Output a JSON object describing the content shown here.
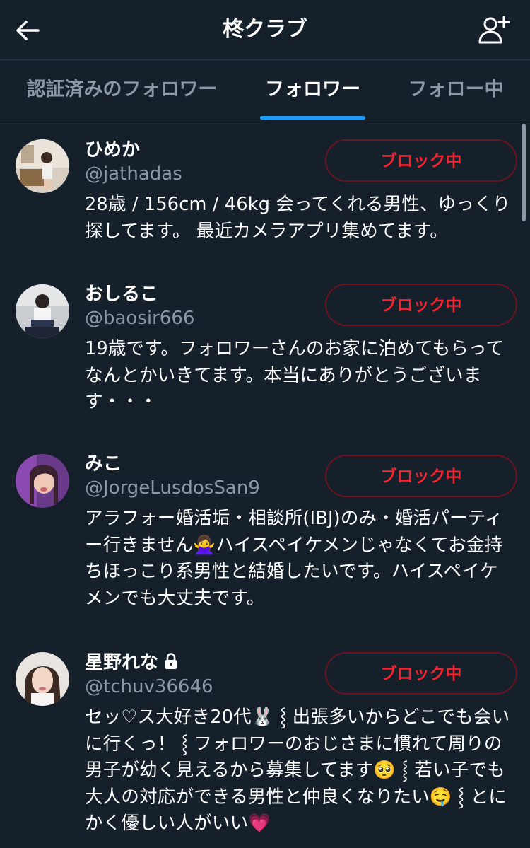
{
  "header": {
    "title": "柊クラブ",
    "back_icon": "arrow-left-icon",
    "add_user_icon": "person-add-icon"
  },
  "tabs": [
    {
      "label": "認証済みのフォロワー",
      "active": false
    },
    {
      "label": "フォロワー",
      "active": true
    },
    {
      "label": "フォロー中",
      "active": false
    }
  ],
  "colors": {
    "background": "#15202b",
    "accent": "#1d9bf0",
    "block_red": "#f4212e",
    "secondary_text": "#8b98a5"
  },
  "followers": [
    {
      "name": "ひめか",
      "handle": "@jathadas",
      "bio": "28歳 / 156cm / 46kg 会ってくれる男性、ゆっくり探してます。 最近カメラアプリ集めてます。",
      "button": "ブロック中",
      "locked": false
    },
    {
      "name": "おしるこ",
      "handle": "@baosir666",
      "bio": "19歳です。フォロワーさんのお家に泊めてもらってなんとかいきてます。本当にありがとうございます・・・",
      "button": "ブロック中",
      "locked": false
    },
    {
      "name": "みこ",
      "handle": "@JorgeLusdosSan9",
      "bio": "アラフォー婚活垢・相談所(IBJ)のみ・婚活パーティー行きません🙅‍♀️ハイスペイケメンじゃなくてお金持ちほっこり系男性と結婚したいです。ハイスペイケメンでも大丈夫です。",
      "button": "ブロック中",
      "locked": false
    },
    {
      "name": "星野れな",
      "handle": "@tchuv36646",
      "bio": "セッ♡ス大好き20代🐰 ⸾ 出張多いからどこでも会いに行くっ！ ⸾ フォロワーのおじさまに慣れて周りの男子が幼く見えるから募集してます🥺 ⸾ 若い子でも大人の対応ができる男性と仲良くなりたい🤤 ⸾ とにかく優しい人がいい💗",
      "button": "ブロック中",
      "locked": true,
      "lock_icon": "lock-icon"
    }
  ]
}
